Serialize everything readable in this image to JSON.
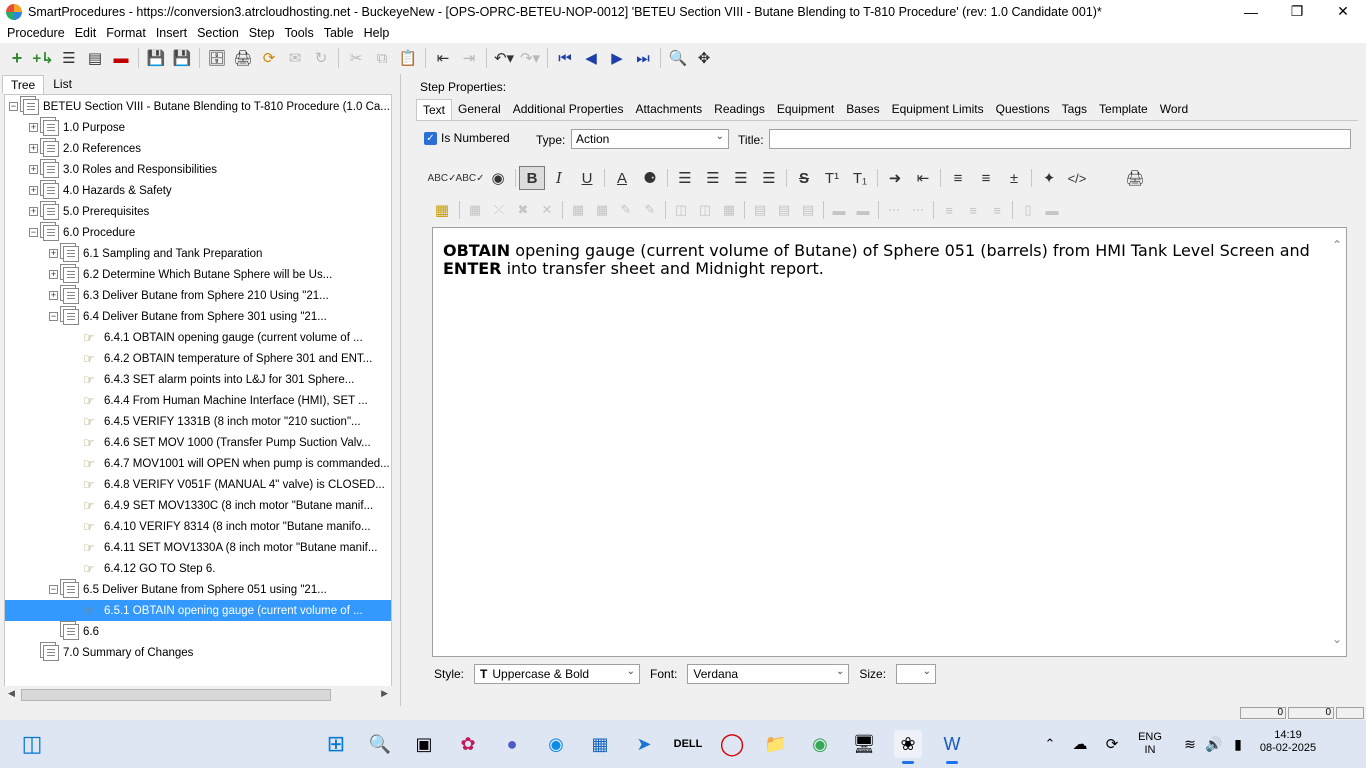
{
  "window": {
    "title": "SmartProcedures - https://conversion3.atrcloudhosting.net - BuckeyeNew - [OPS-OPRC-BETEU-NOP-0012] 'BETEU Section VIII - Butane Blending to T-810 Procedure' (rev: 1.0 Candidate 001)*"
  },
  "menu": [
    "Procedure",
    "Edit",
    "Format",
    "Insert",
    "Section",
    "Step",
    "Tools",
    "Table",
    "Help"
  ],
  "left_tabs": [
    "Tree",
    "List"
  ],
  "tree": [
    {
      "label": "BETEU Section VIII - Butane Blending to T-810 Procedure (1.0 Ca...",
      "depth": 0,
      "expander": "−",
      "icon": "doc-stack"
    },
    {
      "label": "1.0 Purpose",
      "depth": 1,
      "expander": "+",
      "icon": "doc-stack"
    },
    {
      "label": "2.0 References",
      "depth": 1,
      "expander": "+",
      "icon": "doc-stack"
    },
    {
      "label": "3.0 Roles and Responsibilities",
      "depth": 1,
      "expander": "+",
      "icon": "doc-stack"
    },
    {
      "label": "4.0 Hazards & Safety",
      "depth": 1,
      "expander": "+",
      "icon": "doc-stack"
    },
    {
      "label": "5.0 Prerequisites",
      "depth": 1,
      "expander": "+",
      "icon": "doc-stack"
    },
    {
      "label": "6.0 Procedure",
      "depth": 1,
      "expander": "−",
      "icon": "doc-stack"
    },
    {
      "label": "6.1 Sampling and Tank Preparation",
      "depth": 2,
      "expander": "+",
      "icon": "doc-stack"
    },
    {
      "label": "6.2 Determine Which Butane Sphere will be Us...",
      "depth": 2,
      "expander": "+",
      "icon": "doc-stack"
    },
    {
      "label": "6.3 Deliver Butane from Sphere 210 Using \"21...",
      "depth": 2,
      "expander": "+",
      "icon": "doc-stack"
    },
    {
      "label": "6.4 Deliver Butane from Sphere 301 using \"21...",
      "depth": 2,
      "expander": "−",
      "icon": "doc-stack"
    },
    {
      "label": "6.4.1 OBTAIN opening gauge (current volume of ...",
      "depth": 3,
      "expander": "",
      "icon": "hand"
    },
    {
      "label": "6.4.2 OBTAIN temperature of Sphere 301 and ENT...",
      "depth": 3,
      "expander": "",
      "icon": "hand"
    },
    {
      "label": "6.4.3 SET alarm points into L&J for 301 Sphere...",
      "depth": 3,
      "expander": "",
      "icon": "hand"
    },
    {
      "label": "6.4.4 From Human Machine Interface (HMI), SET ...",
      "depth": 3,
      "expander": "",
      "icon": "hand"
    },
    {
      "label": "6.4.5 VERIFY 1331B (8 inch motor \"210 suction\"...",
      "depth": 3,
      "expander": "",
      "icon": "hand"
    },
    {
      "label": "6.4.6 SET MOV 1000 (Transfer Pump Suction Valv...",
      "depth": 3,
      "expander": "",
      "icon": "hand"
    },
    {
      "label": "6.4.7 MOV1001 will OPEN when pump is commanded...",
      "depth": 3,
      "expander": "",
      "icon": "hand"
    },
    {
      "label": "6.4.8 VERIFY V051F (MANUAL 4\" valve) is CLOSED...",
      "depth": 3,
      "expander": "",
      "icon": "hand"
    },
    {
      "label": "6.4.9 SET MOV1330C (8 inch motor \"Butane manif...",
      "depth": 3,
      "expander": "",
      "icon": "hand"
    },
    {
      "label": "6.4.10 VERIFY 8314 (8 inch motor \"Butane manifo...",
      "depth": 3,
      "expander": "",
      "icon": "hand"
    },
    {
      "label": "6.4.11 SET MOV1330A (8 inch motor \"Butane manif...",
      "depth": 3,
      "expander": "",
      "icon": "hand"
    },
    {
      "label": "6.4.12 GO TO Step 6.",
      "depth": 3,
      "expander": "",
      "icon": "hand"
    },
    {
      "label": "6.5 Deliver Butane from Sphere 051 using \"21...",
      "depth": 2,
      "expander": "−",
      "icon": "doc-stack"
    },
    {
      "label": "6.5.1 OBTAIN opening gauge (current volume of ...",
      "depth": 3,
      "expander": "",
      "icon": "hand",
      "selected": true
    },
    {
      "label": "6.6",
      "depth": 2,
      "expander": "",
      "icon": "doc-stack"
    },
    {
      "label": "7.0 Summary of Changes",
      "depth": 1,
      "expander": "",
      "icon": "doc-stack"
    }
  ],
  "step_properties": {
    "label": "Step Properties:",
    "tabs": [
      "Text",
      "General",
      "Additional Properties",
      "Attachments",
      "Readings",
      "Equipment",
      "Bases",
      "Equipment Limits",
      "Questions",
      "Tags",
      "Template",
      "Word"
    ],
    "is_numbered_label": "Is Numbered",
    "type_label": "Type:",
    "type_value": "Action",
    "title_label": "Title:",
    "title_value": ""
  },
  "editor": {
    "segments": [
      {
        "text": "OBTAIN",
        "bold": true
      },
      {
        "text": " opening gauge (current volume of Butane) of Sphere 051 (barrels) from HMI Tank Level Screen and ",
        "bold": false
      },
      {
        "text": "ENTER",
        "bold": true
      },
      {
        "text": " into transfer sheet and Midnight report.",
        "bold": false
      }
    ]
  },
  "bottom": {
    "style_label": "Style:",
    "style_value": "Uppercase & Bold",
    "font_label": "Font:",
    "font_value": "Verdana",
    "size_label": "Size:",
    "size_value": ""
  },
  "status": {
    "cell1": "0",
    "cell2": "0"
  },
  "tray": {
    "lang_line1": "ENG",
    "lang_line2": "IN",
    "time": "14:19",
    "date": "08-02-2025"
  }
}
